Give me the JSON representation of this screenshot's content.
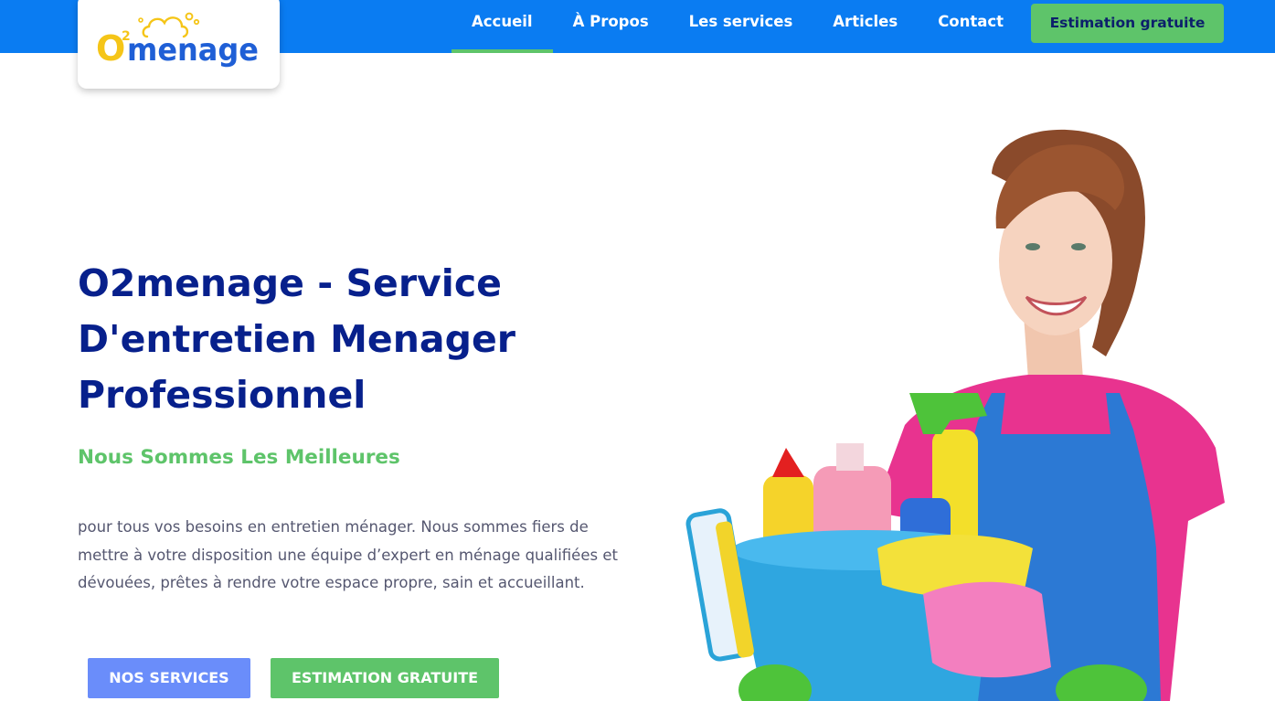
{
  "header": {
    "logo": {
      "text_o": "O",
      "superscript": "2",
      "text_rest": "menage"
    },
    "nav": [
      {
        "label": "Accueil",
        "active": true
      },
      {
        "label": "À Propos",
        "active": false
      },
      {
        "label": "Les services",
        "active": false
      },
      {
        "label": "Articles",
        "active": false
      },
      {
        "label": "Contact",
        "active": false
      }
    ],
    "cta_label": "Estimation gratuite"
  },
  "hero": {
    "title_lines": [
      "O2menage - Service",
      "D'entretien Menager",
      "Professionnel"
    ],
    "subtitle": "Nous Sommes Les Meilleures",
    "description_lines": [
      "pour tous vos besoins en entretien ménager. Nous sommes fiers de",
      "mettre à votre disposition une équipe d’expert en ménage qualifiées et",
      "dévouées, prêtes à rendre votre espace propre, sain et accueillant."
    ],
    "buttons": {
      "services": "NOS SERVICES",
      "estimate": "ESTIMATION GRATUITE"
    }
  },
  "colors": {
    "header_blue": "#0a7cf2",
    "accent_green": "#5ec46a",
    "title_navy": "#07208c",
    "button_blue": "#6a8dfa",
    "logo_yellow": "#f5c518",
    "logo_blue": "#1f5fd6"
  },
  "icons": {
    "logo": "cloud-bubbles-logo-icon",
    "figure": "cleaning-woman-with-bucket-illustration"
  }
}
